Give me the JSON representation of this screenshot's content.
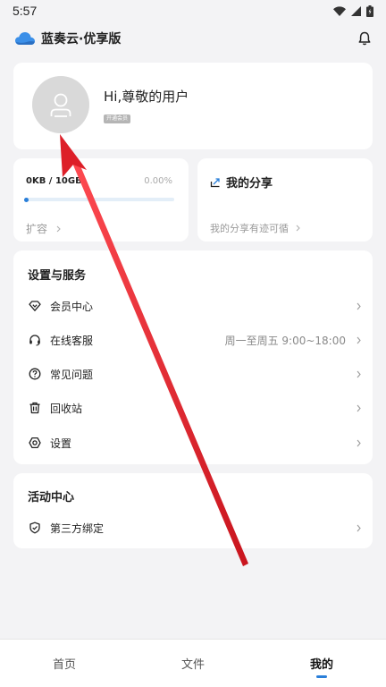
{
  "status_bar": {
    "time": "5:57"
  },
  "header": {
    "app_name": "蓝奏云·优享版"
  },
  "profile": {
    "greeting": "Hi,尊敬的用户",
    "badge": "开通会员"
  },
  "storage": {
    "used": "0KB / 10GB",
    "percent": "0.00%",
    "progress_fraction": 0.0,
    "action": "扩容"
  },
  "share": {
    "title": "我的分享",
    "desc": "我的分享有迹可循"
  },
  "services": {
    "title": "设置与服务",
    "items": [
      {
        "label": "会员中心",
        "extra": "",
        "icon": "diamond-icon"
      },
      {
        "label": "在线客服",
        "extra": "周一至周五 9:00~18:00",
        "icon": "headset-icon"
      },
      {
        "label": "常见问题",
        "extra": "",
        "icon": "question-icon"
      },
      {
        "label": "回收站",
        "extra": "",
        "icon": "trash-icon"
      },
      {
        "label": "设置",
        "extra": "",
        "icon": "gear-icon"
      }
    ]
  },
  "activity": {
    "title": "活动中心",
    "items": [
      {
        "label": "第三方绑定",
        "icon": "shield-icon"
      }
    ]
  },
  "nav": {
    "tabs": [
      {
        "label": "首页",
        "active": false
      },
      {
        "label": "文件",
        "active": false
      },
      {
        "label": "我的",
        "active": true
      }
    ]
  },
  "colors": {
    "accent": "#2a7fd9",
    "arrow": "#e0202a",
    "background": "#f3f3f5"
  }
}
